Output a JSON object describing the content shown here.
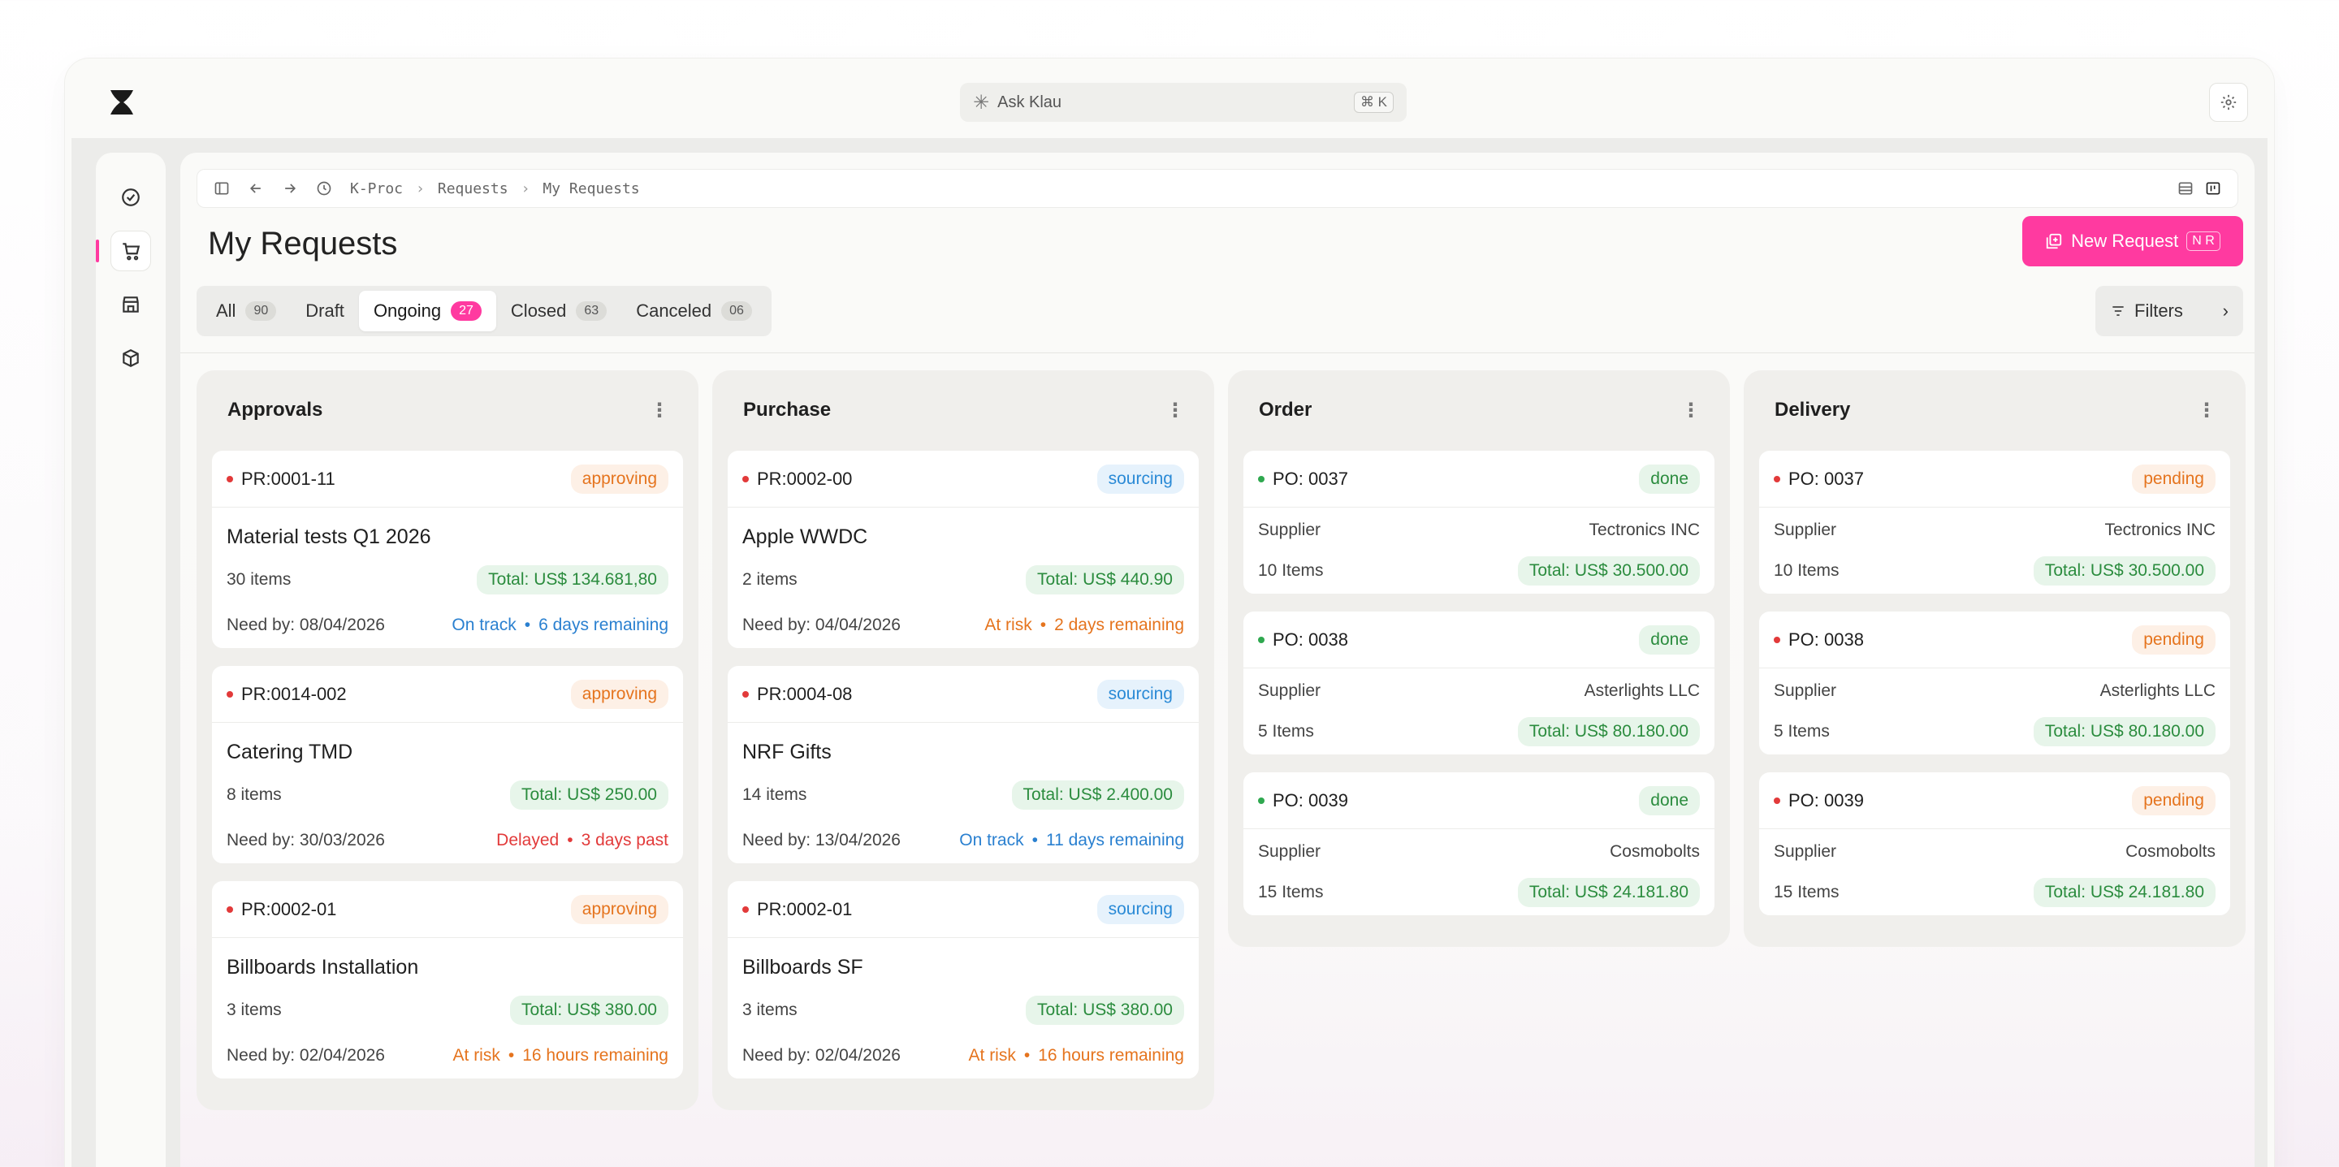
{
  "app": {
    "ask_placeholder": "Ask Klau",
    "ask_shortcut": "⌘ K"
  },
  "breadcrumb": [
    "K-Proc",
    "Requests",
    "My Requests"
  ],
  "page": {
    "title": "My Requests",
    "new_button": "New Request",
    "new_shortcut": "N R",
    "filters_label": "Filters"
  },
  "tabs": [
    {
      "label": "All",
      "count": "90"
    },
    {
      "label": "Draft",
      "count": ""
    },
    {
      "label": "Ongoing",
      "count": "27"
    },
    {
      "label": "Closed",
      "count": "63"
    },
    {
      "label": "Canceled",
      "count": "06"
    }
  ],
  "columns": {
    "approvals": {
      "title": "Approvals",
      "cards": [
        {
          "id": "PR:0001-11",
          "badge": "approving",
          "title": "Material tests Q1 2026",
          "items": "30 items",
          "total": "Total: US$ 134.681,80",
          "need": "Need by: 08/04/2026",
          "status": "On track",
          "remaining": "6 days remaining"
        },
        {
          "id": "PR:0014-002",
          "badge": "approving",
          "title": "Catering TMD",
          "items": "8 items",
          "total": "Total: US$ 250.00",
          "need": "Need by: 30/03/2026",
          "status": "Delayed",
          "remaining": "3 days past"
        },
        {
          "id": "PR:0002-01",
          "badge": "approving",
          "title": "Billboards Installation",
          "items": "3 items",
          "total": "Total: US$ 380.00",
          "need": "Need by: 02/04/2026",
          "status": "At risk",
          "remaining": "16 hours remaining"
        }
      ]
    },
    "purchase": {
      "title": "Purchase",
      "cards": [
        {
          "id": "PR:0002-00",
          "badge": "sourcing",
          "title": "Apple WWDC",
          "items": "2 items",
          "total": "Total: US$ 440.90",
          "need": "Need by: 04/04/2026",
          "status": "At risk",
          "remaining": "2 days remaining"
        },
        {
          "id": "PR:0004-08",
          "badge": "sourcing",
          "title": "NRF Gifts",
          "items": "14 items",
          "total": "Total: US$ 2.400.00",
          "need": "Need by: 13/04/2026",
          "status": "On track",
          "remaining": "11 days remaining"
        },
        {
          "id": "PR:0002-01",
          "badge": "sourcing",
          "title": "Billboards SF",
          "items": "3 items",
          "total": "Total: US$ 380.00",
          "need": "Need by: 02/04/2026",
          "status": "At risk",
          "remaining": "16 hours remaining"
        }
      ]
    },
    "order": {
      "title": "Order",
      "cards": [
        {
          "id": "PO: 0037",
          "badge": "done",
          "supplier_label": "Supplier",
          "supplier": "Tectronics INC",
          "items": "10 Items",
          "total": "Total: US$ 30.500.00"
        },
        {
          "id": "PO: 0038",
          "badge": "done",
          "supplier_label": "Supplier",
          "supplier": "Asterlights LLC",
          "items": "5 Items",
          "total": "Total: US$ 80.180.00"
        },
        {
          "id": "PO: 0039",
          "badge": "done",
          "supplier_label": "Supplier",
          "supplier": "Cosmobolts",
          "items": "15 Items",
          "total": "Total: US$ 24.181.80"
        }
      ]
    },
    "delivery": {
      "title": "Delivery",
      "cards": [
        {
          "id": "PO: 0037",
          "badge": "pending",
          "supplier_label": "Supplier",
          "supplier": "Tectronics INC",
          "items": "10 Items",
          "total": "Total: US$ 30.500.00"
        },
        {
          "id": "PO: 0038",
          "badge": "pending",
          "supplier_label": "Supplier",
          "supplier": "Asterlights LLC",
          "items": "5 Items",
          "total": "Total: US$ 80.180.00"
        },
        {
          "id": "PO: 0039",
          "badge": "pending",
          "supplier_label": "Supplier",
          "supplier": "Cosmobolts",
          "items": "15 Items",
          "total": "Total: US$ 24.181.80"
        }
      ]
    }
  },
  "colors": {
    "accent": "#ff3aa0",
    "on_track": "#2a80d0",
    "at_risk": "#e5741e",
    "delayed": "#e23a3a",
    "total_green": "#2b8c3e"
  }
}
